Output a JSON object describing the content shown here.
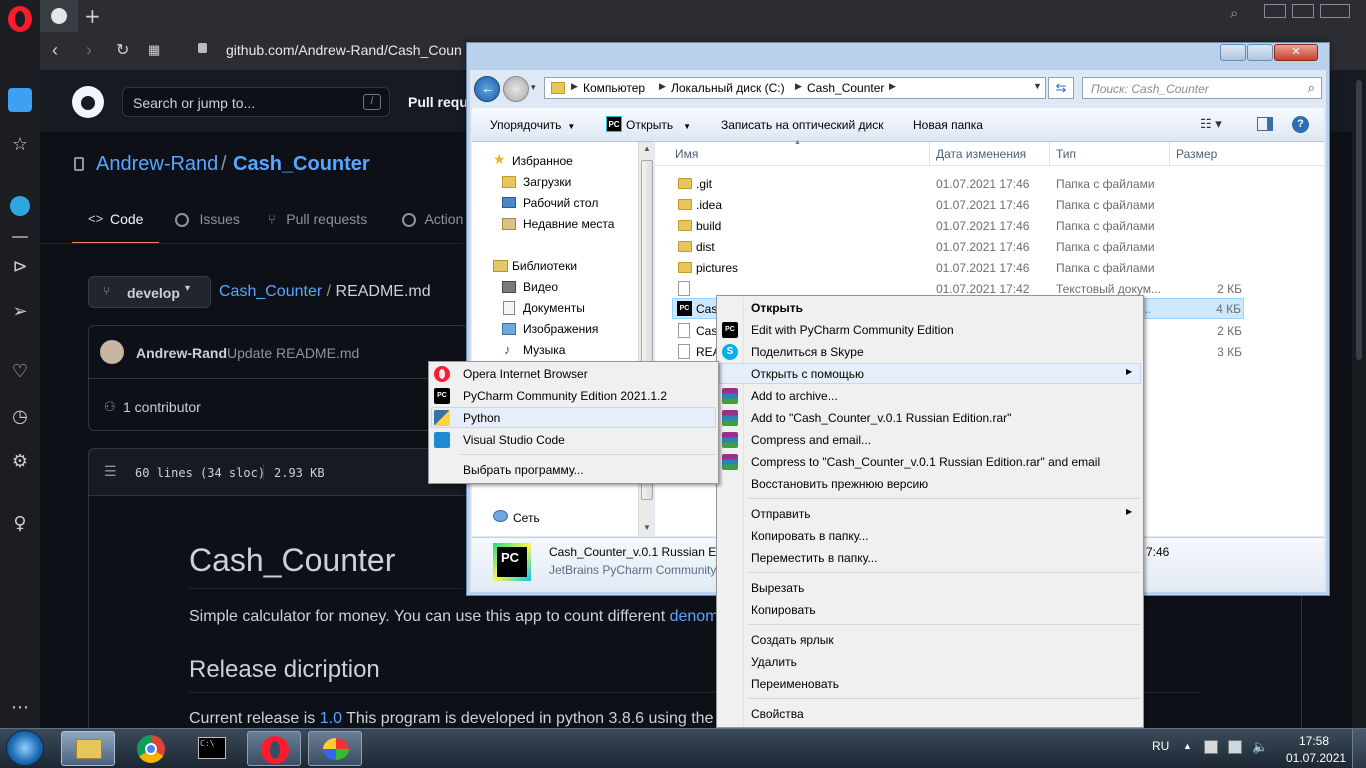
{
  "browser": {
    "address": "github.com/Andrew-Rand/Cash_Counter",
    "sidebar_icons": [
      "opera-logo",
      "home-icon",
      "star-icon",
      "telegram-icon",
      "minus-icon",
      "play-icon",
      "send-icon",
      "heart-icon",
      "clock-icon",
      "gear-icon",
      "lightbulb-icon",
      "more-icon"
    ]
  },
  "github": {
    "search_placeholder": "Search or jump to...",
    "search_key": "/",
    "pull_requests_nav": "Pull requ",
    "owner": "Andrew-Rand",
    "separator": "/",
    "repo": "Cash_Counter",
    "tabs": [
      "Code",
      "Issues",
      "Pull requests",
      "Action"
    ],
    "branch": "develop",
    "path_repo": "Cash_Counter",
    "path_sep": " / ",
    "path_file": "README.md",
    "commit_author": "Andrew-Rand",
    "commit_msg": "Update README.md",
    "contributors": "1 contributor",
    "file_info_lines": "60 lines (34 sloc)",
    "file_info_size": "2.93 KB",
    "readme_title": "Cash_Counter",
    "readme_p1": "Simple calculator for money. You can use this app to count different ",
    "readme_p1_link": "denom",
    "readme_h2": "Release dicription",
    "readme_p2_a": "Current release is ",
    "readme_p2_link": "1.0",
    "readme_p2_b": " This program is developed in python 3.8.6 using the T"
  },
  "explorer": {
    "breadcrumb": [
      "Компьютер",
      "Локальный диск (C:)",
      "Cash_Counter"
    ],
    "search_placeholder": "Поиск: Cash_Counter",
    "toolbar": {
      "organize": "Упорядочить",
      "open": "Открыть",
      "burn": "Записать на оптический диск",
      "new_folder": "Новая папка"
    },
    "nav": {
      "favorites": "Избранное",
      "fav_items": [
        "Загрузки",
        "Рабочий стол",
        "Недавние места"
      ],
      "libraries": "Библиотеки",
      "lib_items": [
        "Видео",
        "Документы",
        "Изображения",
        "Музыка"
      ],
      "network": "Сеть"
    },
    "columns": [
      "Имя",
      "Дата изменения",
      "Тип",
      "Размер"
    ],
    "files": [
      {
        "name": ".git",
        "date": "01.07.2021 17:46",
        "type": "Папка с файлами",
        "size": ""
      },
      {
        "name": ".idea",
        "date": "01.07.2021 17:46",
        "type": "Папка с файлами",
        "size": ""
      },
      {
        "name": "build",
        "date": "01.07.2021 17:46",
        "type": "Папка с файлами",
        "size": ""
      },
      {
        "name": "dist",
        "date": "01.07.2021 17:46",
        "type": "Папка с файлами",
        "size": ""
      },
      {
        "name": "pictures",
        "date": "01.07.2021 17:46",
        "type": "Папка с файлами",
        "size": ""
      },
      {
        "name": "",
        "date": "01.07.2021 17:42",
        "type": "Текстовый докум...",
        "size": "2 КБ"
      },
      {
        "name": "Cas",
        "date": "",
        "type": "...",
        "size": "4 КБ"
      },
      {
        "name": "Cas",
        "date": "",
        "type": "",
        "size": "2 КБ"
      },
      {
        "name": "REA",
        "date": "",
        "type": "",
        "size": "3 КБ"
      }
    ],
    "details_name": "Cash_Counter_v.0.1 Russian E",
    "details_app": "JetBrains PyCharm Community",
    "details_time": "7:46"
  },
  "context_menu": {
    "items": [
      "Открыть",
      "Edit with PyCharm Community Edition",
      "Поделиться в Skype",
      "Открыть с помощью",
      "Add to archive...",
      "Add to \"Cash_Counter_v.0.1 Russian Edition.rar\"",
      "Compress and email...",
      "Compress to \"Cash_Counter_v.0.1 Russian Edition.rar\" and email",
      "Восстановить прежнюю версию",
      "Отправить",
      "Копировать в папку...",
      "Переместить в папку...",
      "Вырезать",
      "Копировать",
      "Создать ярлык",
      "Удалить",
      "Переименовать",
      "Свойства"
    ]
  },
  "open_with_menu": {
    "items": [
      "Opera Internet Browser",
      "PyCharm Community Edition 2021.1.2",
      "Python",
      "Visual Studio Code",
      "Выбрать программу..."
    ]
  },
  "taskbar": {
    "lang": "RU",
    "time": "17:58",
    "date": "01.07.2021"
  }
}
